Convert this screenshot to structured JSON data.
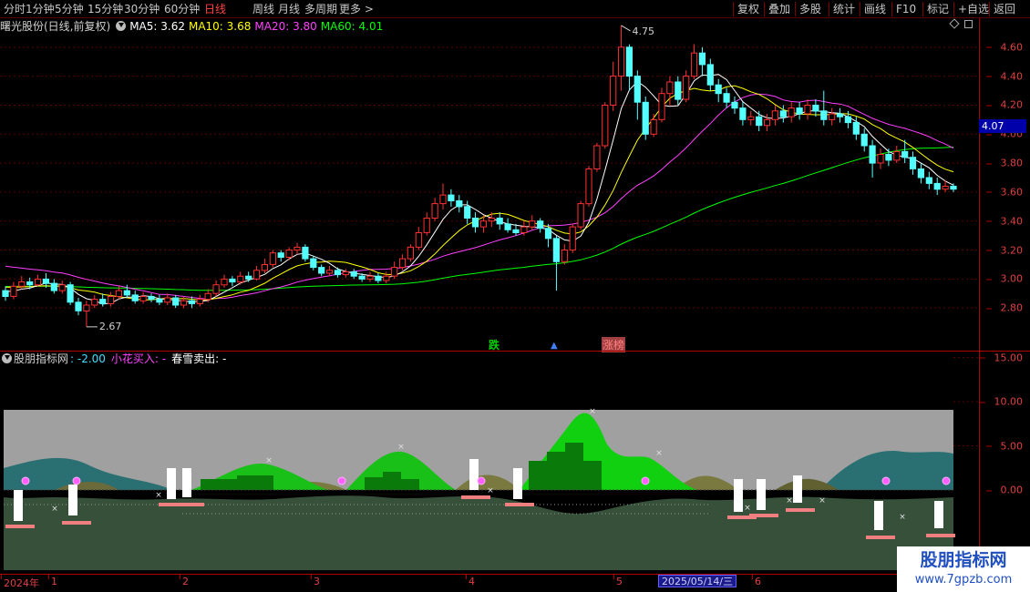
{
  "toolbar": {
    "left": [
      "分时",
      "1分钟",
      "5分钟",
      "15分钟",
      "30分钟",
      "60分钟",
      "日线",
      "周线",
      "月线",
      "多周期",
      "更多 >"
    ],
    "active_index": 6,
    "right": [
      "复权",
      "叠加",
      "多股",
      "统计",
      "画线",
      "F10",
      "标记",
      "+自选",
      "返回"
    ]
  },
  "main_info": {
    "title": "曙光股份(日线,前复权)",
    "ma5_label": "MA5: 3.62",
    "ma10_label": "MA10: 3.68",
    "ma20_label": "MA20: 3.80",
    "ma60_label": "MA60: 4.01",
    "colors": {
      "ma5": "#ffffff",
      "ma10": "#ffff00",
      "ma20": "#ff40ff",
      "ma60": "#00ff00"
    }
  },
  "price_axis": {
    "ticks": [
      "4.60",
      "4.40",
      "4.20",
      "4.00",
      "3.80",
      "3.60",
      "3.40",
      "3.20",
      "3.00",
      "2.80"
    ],
    "current_price": "4.07"
  },
  "annotations": {
    "high": "4.75",
    "low": "2.67",
    "die": "跌",
    "zhangbang": "涨榜"
  },
  "indicator_info": {
    "name": "股朋指标网",
    "value": ": -2.00",
    "buy_label": "小花买入: -",
    "sell_label": "春雪卖出: -"
  },
  "indicator_axis": {
    "ticks": [
      "15.00",
      "10.00",
      "5.00",
      "0.00"
    ]
  },
  "time_axis": {
    "labels": [
      "2024年",
      "1",
      "2",
      "3",
      "4",
      "5",
      "6"
    ],
    "current_date": "2025/05/14/三"
  },
  "watermark": {
    "name": "股朋指标网",
    "url": "www.7gpzb.com"
  },
  "chart_data": {
    "type": "candlestick",
    "title": "曙光股份(日线,前复权)",
    "ylim": [
      2.6,
      4.8
    ],
    "candles": [
      [
        2.92,
        2.88,
        2.95,
        2.85
      ],
      [
        2.88,
        2.95,
        2.98,
        2.86
      ],
      [
        2.95,
        2.98,
        3.02,
        2.93
      ],
      [
        2.98,
        2.96,
        3.01,
        2.93
      ],
      [
        2.96,
        3.0,
        3.03,
        2.95
      ],
      [
        3.0,
        2.97,
        3.04,
        2.94
      ],
      [
        2.97,
        2.92,
        3.0,
        2.9
      ],
      [
        2.92,
        2.96,
        2.99,
        2.9
      ],
      [
        2.96,
        2.84,
        2.98,
        2.82
      ],
      [
        2.84,
        2.78,
        2.87,
        2.75
      ],
      [
        2.78,
        2.82,
        2.85,
        2.67
      ],
      [
        2.82,
        2.86,
        2.89,
        2.8
      ],
      [
        2.86,
        2.83,
        2.9,
        2.81
      ],
      [
        2.83,
        2.88,
        2.91,
        2.81
      ],
      [
        2.88,
        2.92,
        2.95,
        2.86
      ],
      [
        2.92,
        2.89,
        2.96,
        2.87
      ],
      [
        2.89,
        2.85,
        2.92,
        2.83
      ],
      [
        2.85,
        2.88,
        2.91,
        2.83
      ],
      [
        2.88,
        2.86,
        2.9,
        2.84
      ],
      [
        2.86,
        2.84,
        2.89,
        2.82
      ],
      [
        2.84,
        2.87,
        2.9,
        2.82
      ],
      [
        2.87,
        2.82,
        2.89,
        2.8
      ],
      [
        2.82,
        2.85,
        2.88,
        2.8
      ],
      [
        2.85,
        2.83,
        2.88,
        2.8
      ],
      [
        2.83,
        2.86,
        2.89,
        2.81
      ],
      [
        2.86,
        2.9,
        2.93,
        2.84
      ],
      [
        2.9,
        2.96,
        2.99,
        2.88
      ],
      [
        2.96,
        3.0,
        3.03,
        2.94
      ],
      [
        3.0,
        2.98,
        3.02,
        2.95
      ],
      [
        2.98,
        3.02,
        3.05,
        2.96
      ],
      [
        3.02,
        3.0,
        3.05,
        2.98
      ],
      [
        3.0,
        3.06,
        3.09,
        2.99
      ],
      [
        3.06,
        3.1,
        3.14,
        3.04
      ],
      [
        3.1,
        3.18,
        3.2,
        3.08
      ],
      [
        3.18,
        3.15,
        3.2,
        3.12
      ],
      [
        3.15,
        3.2,
        3.22,
        3.13
      ],
      [
        3.2,
        3.22,
        3.25,
        3.17
      ],
      [
        3.22,
        3.14,
        3.24,
        3.12
      ],
      [
        3.14,
        3.08,
        3.16,
        3.06
      ],
      [
        3.08,
        3.04,
        3.1,
        3.02
      ],
      [
        3.04,
        3.06,
        3.09,
        3.02
      ],
      [
        3.06,
        3.03,
        3.08,
        3.01
      ],
      [
        3.03,
        3.05,
        3.07,
        3.01
      ],
      [
        3.05,
        3.02,
        3.07,
        3.0
      ],
      [
        3.02,
        3.0,
        3.04,
        2.98
      ],
      [
        3.0,
        3.02,
        3.05,
        2.98
      ],
      [
        3.02,
        2.99,
        3.04,
        2.97
      ],
      [
        2.99,
        3.02,
        3.05,
        2.97
      ],
      [
        3.02,
        3.08,
        3.12,
        3.0
      ],
      [
        3.08,
        3.14,
        3.17,
        3.06
      ],
      [
        3.14,
        3.22,
        3.24,
        3.12
      ],
      [
        3.22,
        3.32,
        3.36,
        3.2
      ],
      [
        3.32,
        3.42,
        3.46,
        3.3
      ],
      [
        3.42,
        3.52,
        3.56,
        3.4
      ],
      [
        3.52,
        3.58,
        3.66,
        3.48
      ],
      [
        3.58,
        3.54,
        3.62,
        3.5
      ],
      [
        3.54,
        3.5,
        3.58,
        3.46
      ],
      [
        3.5,
        3.42,
        3.54,
        3.38
      ],
      [
        3.42,
        3.36,
        3.46,
        3.32
      ],
      [
        3.36,
        3.4,
        3.44,
        3.32
      ],
      [
        3.4,
        3.42,
        3.46,
        3.36
      ],
      [
        3.42,
        3.38,
        3.46,
        3.34
      ],
      [
        3.38,
        3.34,
        3.42,
        3.32
      ],
      [
        3.34,
        3.32,
        3.38,
        3.3
      ],
      [
        3.32,
        3.36,
        3.4,
        3.3
      ],
      [
        3.36,
        3.4,
        3.44,
        3.34
      ],
      [
        3.4,
        3.35,
        3.42,
        3.32
      ],
      [
        3.35,
        3.28,
        3.38,
        3.22
      ],
      [
        3.28,
        3.12,
        3.3,
        2.92
      ],
      [
        3.12,
        3.2,
        3.24,
        3.1
      ],
      [
        3.2,
        3.36,
        3.38,
        3.18
      ],
      [
        3.36,
        3.52,
        3.54,
        3.34
      ],
      [
        3.52,
        3.76,
        3.78,
        3.5
      ],
      [
        3.76,
        3.92,
        3.94,
        3.74
      ],
      [
        3.92,
        4.2,
        4.22,
        3.9
      ],
      [
        4.2,
        4.4,
        4.5,
        4.16
      ],
      [
        4.4,
        4.6,
        4.75,
        4.3
      ],
      [
        4.6,
        4.4,
        4.62,
        4.3
      ],
      [
        4.4,
        4.22,
        4.44,
        4.1
      ],
      [
        4.22,
        4.0,
        4.26,
        3.96
      ],
      [
        4.0,
        4.1,
        4.14,
        3.98
      ],
      [
        4.1,
        4.28,
        4.32,
        4.08
      ],
      [
        4.28,
        4.36,
        4.4,
        4.2
      ],
      [
        4.36,
        4.24,
        4.4,
        4.2
      ],
      [
        4.24,
        4.4,
        4.44,
        4.22
      ],
      [
        4.4,
        4.56,
        4.62,
        4.38
      ],
      [
        4.56,
        4.48,
        4.6,
        4.4
      ],
      [
        4.48,
        4.34,
        4.52,
        4.3
      ],
      [
        4.34,
        4.28,
        4.38,
        4.22
      ],
      [
        4.28,
        4.22,
        4.32,
        4.18
      ],
      [
        4.22,
        4.18,
        4.26,
        4.14
      ],
      [
        4.18,
        4.1,
        4.22,
        4.06
      ],
      [
        4.1,
        4.12,
        4.16,
        4.06
      ],
      [
        4.12,
        4.06,
        4.16,
        4.02
      ],
      [
        4.06,
        4.1,
        4.14,
        4.02
      ],
      [
        4.1,
        4.16,
        4.2,
        4.06
      ],
      [
        4.16,
        4.12,
        4.2,
        4.08
      ],
      [
        4.12,
        4.18,
        4.22,
        4.08
      ],
      [
        4.18,
        4.14,
        4.22,
        4.1
      ],
      [
        4.14,
        4.2,
        4.24,
        4.1
      ],
      [
        4.2,
        4.16,
        4.24,
        4.12
      ],
      [
        4.16,
        4.1,
        4.3,
        4.06
      ],
      [
        4.1,
        4.14,
        4.18,
        4.06
      ],
      [
        4.14,
        4.12,
        4.18,
        4.08
      ],
      [
        4.12,
        4.08,
        4.16,
        4.04
      ],
      [
        4.08,
        4.0,
        4.12,
        3.96
      ],
      [
        4.0,
        3.92,
        4.04,
        3.88
      ],
      [
        3.92,
        3.8,
        3.96,
        3.7
      ],
      [
        3.8,
        3.86,
        3.9,
        3.76
      ],
      [
        3.86,
        3.82,
        3.9,
        3.78
      ],
      [
        3.82,
        3.88,
        3.92,
        3.8
      ],
      [
        3.88,
        3.84,
        3.96,
        3.8
      ],
      [
        3.84,
        3.76,
        3.88,
        3.72
      ],
      [
        3.76,
        3.7,
        3.8,
        3.66
      ],
      [
        3.7,
        3.66,
        3.74,
        3.62
      ],
      [
        3.66,
        3.62,
        3.7,
        3.58
      ],
      [
        3.62,
        3.64,
        3.68,
        3.6
      ],
      [
        3.64,
        3.62,
        3.66,
        3.6
      ]
    ],
    "series": [
      {
        "name": "MA5",
        "color": "#ffffff",
        "values": "computed from candles"
      },
      {
        "name": "MA10",
        "color": "#ffff00",
        "values": "computed from candles"
      },
      {
        "name": "MA20",
        "color": "#ff40ff",
        "values": "computed from candles"
      },
      {
        "name": "MA60",
        "color": "#00ff00",
        "values": "computed from candles"
      }
    ]
  }
}
